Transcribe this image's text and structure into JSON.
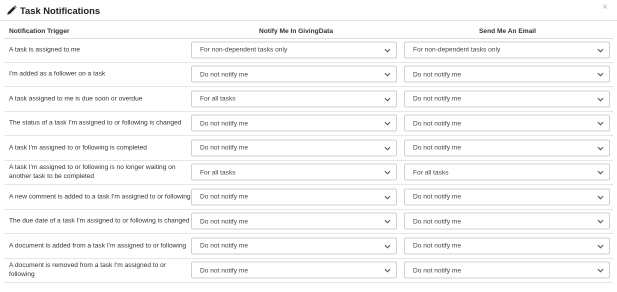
{
  "modal": {
    "title": "Task Notifications",
    "close_glyph": "×",
    "title_icon": "pencil-icon",
    "close_icon": "close-icon"
  },
  "columns": {
    "trigger": "Notification Trigger",
    "app": "Notify Me In GivingData",
    "email": "Send Me An Email"
  },
  "rows": [
    {
      "trigger": "A task is assigned to me",
      "app": "For non-dependent tasks only",
      "email": "For non-dependent tasks only"
    },
    {
      "trigger": "I'm added as a follower on a task",
      "app": "Do not notify me",
      "email": "Do not notify me"
    },
    {
      "trigger": "A task assigned to me is due soon or overdue",
      "app": "For all tasks",
      "email": "Do not notify me"
    },
    {
      "trigger": "The status of a task I'm assigned to or following is changed",
      "app": "Do not notify me",
      "email": "Do not notify me"
    },
    {
      "trigger": "A task I'm assigned to or following is completed",
      "app": "Do not notify me",
      "email": "Do not notify me"
    },
    {
      "trigger": "A task I'm assigned to or following is no longer waiting on another task to be completed",
      "app": "For all tasks",
      "email": "For all tasks"
    },
    {
      "trigger": "A new comment is added to a task I'm assigned to or following",
      "app": "Do not notify me",
      "email": "Do not notify me"
    },
    {
      "trigger": "The due date of a task I'm assigned to or following is changed",
      "app": "Do not notify me",
      "email": "Do not notify me"
    },
    {
      "trigger": "A document is added from a task I'm assigned to or following",
      "app": "Do not notify me",
      "email": "Do not notify me"
    },
    {
      "trigger": "A document is removed from a task I'm assigned to or following",
      "app": "Do not notify me",
      "email": "Do not notify me"
    }
  ],
  "select_icon": "chevron-down-icon"
}
